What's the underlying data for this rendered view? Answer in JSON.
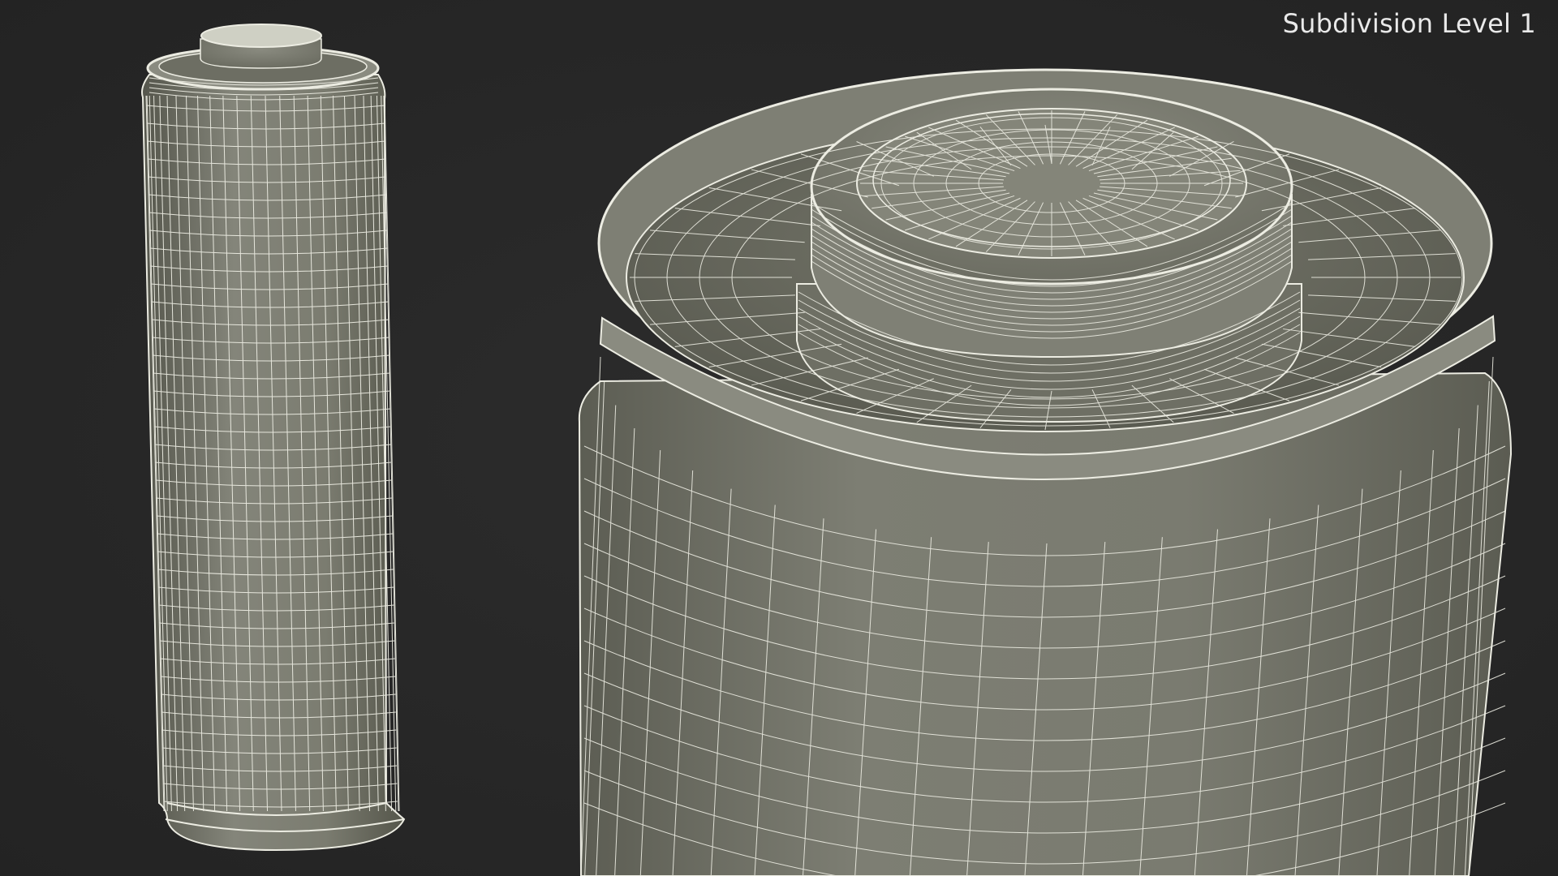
{
  "render": {
    "label": "Subdivision Level 1"
  },
  "colors": {
    "background": "#272727",
    "surface": "#7c7d70",
    "wire": "#ecece2"
  }
}
